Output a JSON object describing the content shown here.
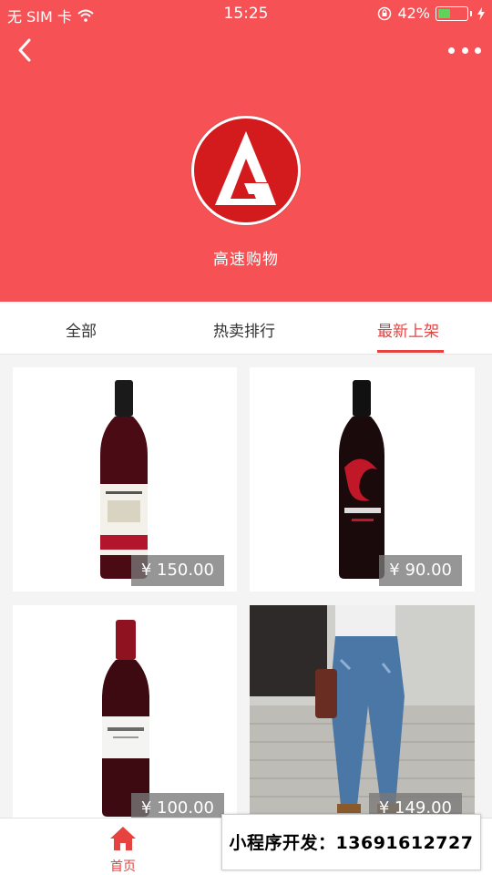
{
  "status_bar": {
    "carrier": "无 SIM 卡",
    "time": "15:25",
    "battery_percent": "42%",
    "battery_level": 0.42,
    "icons": [
      "wifi-icon",
      "orientation-lock-icon",
      "battery-icon",
      "charging-icon"
    ]
  },
  "nav": {
    "back_icon": "chevron-left-icon",
    "more_icon": "more-dots-icon"
  },
  "shop": {
    "name": "高速购物",
    "logo": "shop-logo-g"
  },
  "tabs": [
    {
      "label": "全部",
      "active": false
    },
    {
      "label": "热卖排行",
      "active": false
    },
    {
      "label": "最新上架",
      "active": true
    }
  ],
  "products": [
    {
      "price": "¥ 150.00",
      "image": "wine-bottle-tyrrells"
    },
    {
      "price": "¥ 90.00",
      "image": "wine-bottle-osaado"
    },
    {
      "price": "¥ 100.00",
      "image": "wine-bottle-emporio"
    },
    {
      "price": "¥ 149.00",
      "image": "jeans-photo"
    }
  ],
  "bottom_bar": {
    "home_label": "首页",
    "home_icon": "home-icon"
  },
  "watermark": "小程序开发：13691612727",
  "colors": {
    "header_bg": "#f65256",
    "accent": "#e64340",
    "logo_red": "#d31b1e"
  }
}
